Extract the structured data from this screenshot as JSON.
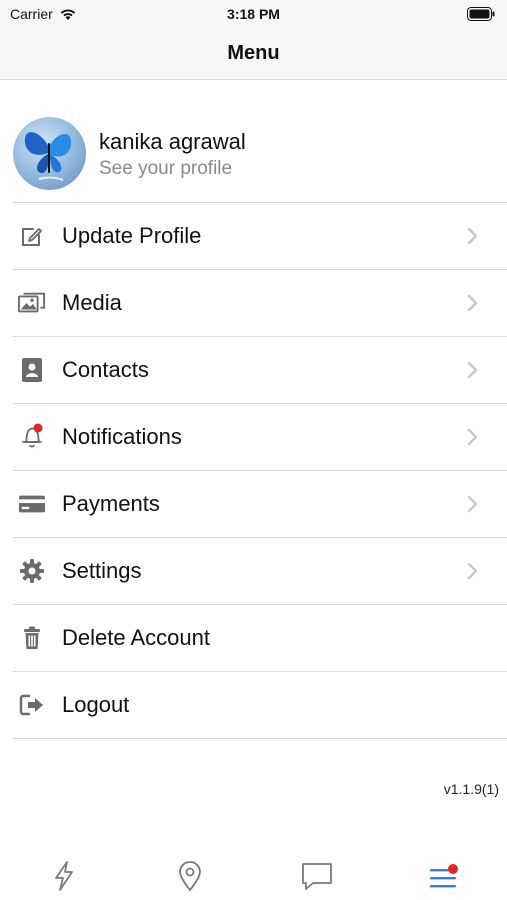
{
  "status_bar": {
    "carrier": "Carrier",
    "time": "3:18 PM"
  },
  "nav": {
    "title": "Menu"
  },
  "profile": {
    "name": "kanika agrawal",
    "subtitle": "See your profile"
  },
  "menu": {
    "items": [
      {
        "label": "Update Profile",
        "icon": "edit-icon",
        "chevron": true
      },
      {
        "label": "Media",
        "icon": "media-icon",
        "chevron": true
      },
      {
        "label": "Contacts",
        "icon": "contacts-icon",
        "chevron": true
      },
      {
        "label": "Notifications",
        "icon": "bell-icon",
        "chevron": true,
        "badge": true
      },
      {
        "label": "Payments",
        "icon": "credit-card-icon",
        "chevron": true
      },
      {
        "label": "Settings",
        "icon": "gear-icon",
        "chevron": true
      },
      {
        "label": "Delete Account",
        "icon": "trash-icon",
        "chevron": false
      },
      {
        "label": "Logout",
        "icon": "logout-icon",
        "chevron": false
      }
    ]
  },
  "version": "v1.1.9(1)",
  "tabs": [
    {
      "icon": "lightning-icon",
      "active": false
    },
    {
      "icon": "location-pin-icon",
      "active": false
    },
    {
      "icon": "chat-bubble-icon",
      "active": false
    },
    {
      "icon": "menu-lines-icon",
      "active": true,
      "badge": true
    }
  ],
  "colors": {
    "badge_red": "#e2262b",
    "active_tab_blue": "#2e7fd6",
    "icon_gray": "#6b6b6b",
    "chevron_gray": "#c7c7cc",
    "divider": "#d9d9d9"
  }
}
